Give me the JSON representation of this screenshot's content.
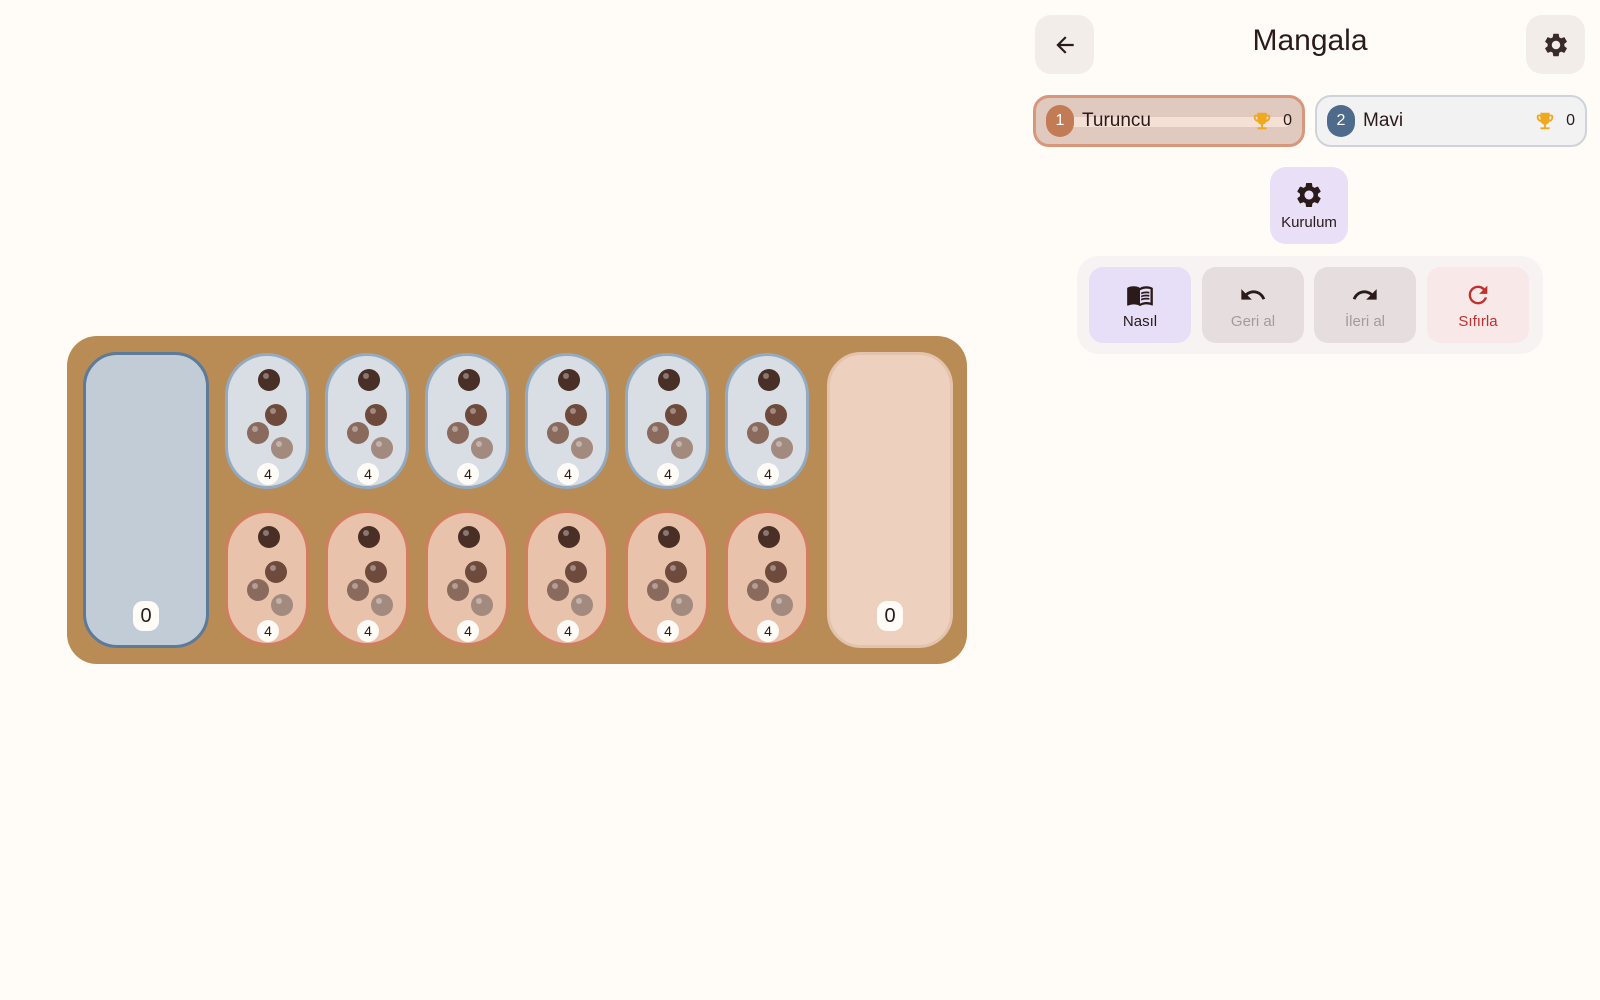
{
  "header": {
    "title": "Mangala"
  },
  "players": [
    {
      "number": "1",
      "name": "Turuncu",
      "score": "0",
      "active": true
    },
    {
      "number": "2",
      "name": "Mavi",
      "score": "0",
      "active": false
    }
  ],
  "setup": {
    "label": "Kurulum"
  },
  "actions": {
    "how": "Nasıl",
    "undo": "Geri al",
    "redo": "İleri al",
    "reset": "Sıfırla"
  },
  "board": {
    "left_store": "0",
    "right_store": "0",
    "top_pits": [
      "4",
      "4",
      "4",
      "4",
      "4",
      "4"
    ],
    "bottom_pits": [
      "4",
      "4",
      "4",
      "4",
      "4",
      "4"
    ]
  },
  "colors": {
    "board": "#b98b55",
    "player1": "#c27b54",
    "player2": "#4f6b8c",
    "accent_reset": "#c0302f"
  },
  "icons": {
    "back": "arrow-left-icon",
    "settings": "gear-icon",
    "trophy": "trophy-icon",
    "how": "book-icon",
    "undo": "undo-icon",
    "redo": "redo-icon",
    "reset": "refresh-icon"
  }
}
